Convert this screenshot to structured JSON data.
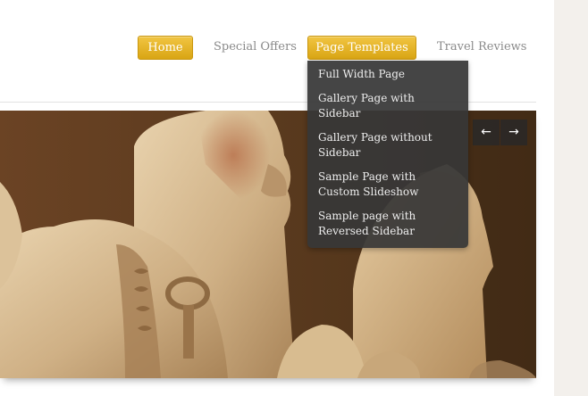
{
  "nav": {
    "items": [
      {
        "label": "Home",
        "active": true
      },
      {
        "label": "Special Offers",
        "active": false
      },
      {
        "label": "Page Templates",
        "active": true
      },
      {
        "label": "Travel Reviews",
        "active": false
      }
    ]
  },
  "dropdown": {
    "items": [
      {
        "label": "Full Width Page"
      },
      {
        "label": "Gallery Page with Sidebar"
      },
      {
        "label": "Gallery Page without Sidebar"
      },
      {
        "label": "Sample Page with Custom Slideshow"
      },
      {
        "label": "Sample page with Reversed Sidebar"
      }
    ]
  },
  "slider": {
    "prev_label": "←",
    "next_label": "→",
    "image": "egyptian-pharaoh-statues"
  },
  "colors": {
    "accent": "#e0ae1f",
    "nav_text": "#8a8a8a",
    "dropdown_bg": "#373737",
    "page_side": "#f3f0ec"
  }
}
